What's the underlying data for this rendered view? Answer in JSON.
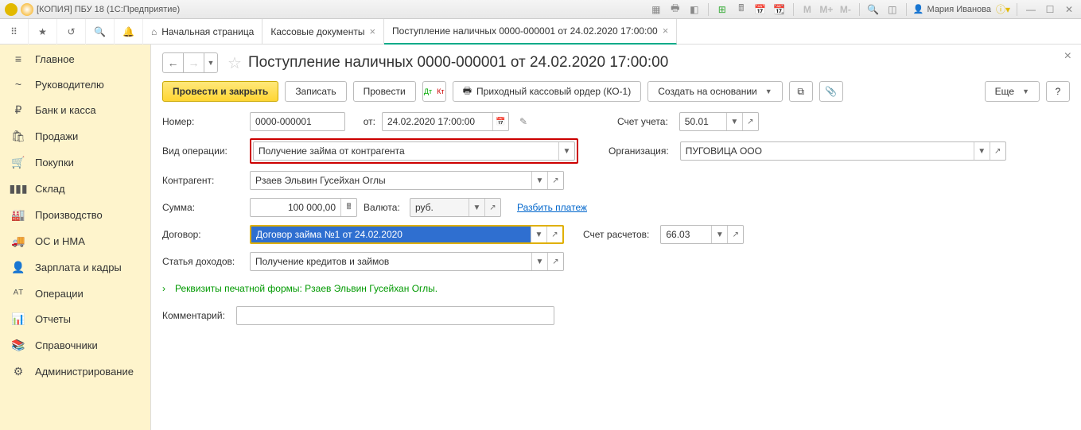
{
  "window": {
    "title": "[КОПИЯ] ПБУ 18  (1С:Предприятие)",
    "user": "Мария Иванова"
  },
  "toolbar_labels": {
    "m": "M",
    "mplus": "M+",
    "mminus": "M-"
  },
  "tabs": {
    "home": "Начальная страница",
    "t1": "Кассовые документы",
    "t2": "Поступление наличных 0000-000001 от 24.02.2020 17:00:00"
  },
  "sidebar": [
    {
      "icon": "≡",
      "label": "Главное"
    },
    {
      "icon": "~",
      "label": "Руководителю"
    },
    {
      "icon": "₽",
      "label": "Банк и касса"
    },
    {
      "icon": "🛍",
      "label": "Продажи"
    },
    {
      "icon": "🛒",
      "label": "Покупки"
    },
    {
      "icon": "▮▮▮",
      "label": "Склад"
    },
    {
      "icon": "🏭",
      "label": "Производство"
    },
    {
      "icon": "🚚",
      "label": "ОС и НМА"
    },
    {
      "icon": "👤",
      "label": "Зарплата и кадры"
    },
    {
      "icon": "ᴬᵀ",
      "label": "Операции"
    },
    {
      "icon": "📊",
      "label": "Отчеты"
    },
    {
      "icon": "📚",
      "label": "Справочники"
    },
    {
      "icon": "⚙",
      "label": "Администрирование"
    }
  ],
  "page": {
    "title": "Поступление наличных 0000-000001 от 24.02.2020 17:00:00"
  },
  "commands": {
    "post_close": "Провести и закрыть",
    "save": "Записать",
    "post": "Провести",
    "print": "Приходный кассовый ордер (КО-1)",
    "create_based": "Создать на основании",
    "more": "Еще"
  },
  "form": {
    "number_label": "Номер:",
    "number_value": "0000-000001",
    "from_label": "от:",
    "date_value": "24.02.2020 17:00:00",
    "account_label": "Счет учета:",
    "account_value": "50.01",
    "operation_label": "Вид операции:",
    "operation_value": "Получение займа от контрагента",
    "org_label": "Организация:",
    "org_value": "ПУГОВИЦА ООО",
    "counterparty_label": "Контрагент:",
    "counterparty_value": "Рзаев Эльвин Гусейхан Оглы",
    "sum_label": "Сумма:",
    "sum_value": "100 000,00",
    "currency_label": "Валюта:",
    "currency_value": "руб.",
    "split_link": "Разбить платеж",
    "contract_label": "Договор:",
    "contract_value": "Договор займа №1 от 24.02.2020",
    "settle_label": "Счет расчетов:",
    "settle_value": "66.03",
    "income_label": "Статья доходов:",
    "income_value": "Получение кредитов и займов",
    "requisites_link": "Реквизиты печатной формы: Рзаев Эльвин Гусейхан Оглы.",
    "comment_label": "Комментарий:",
    "comment_value": ""
  }
}
